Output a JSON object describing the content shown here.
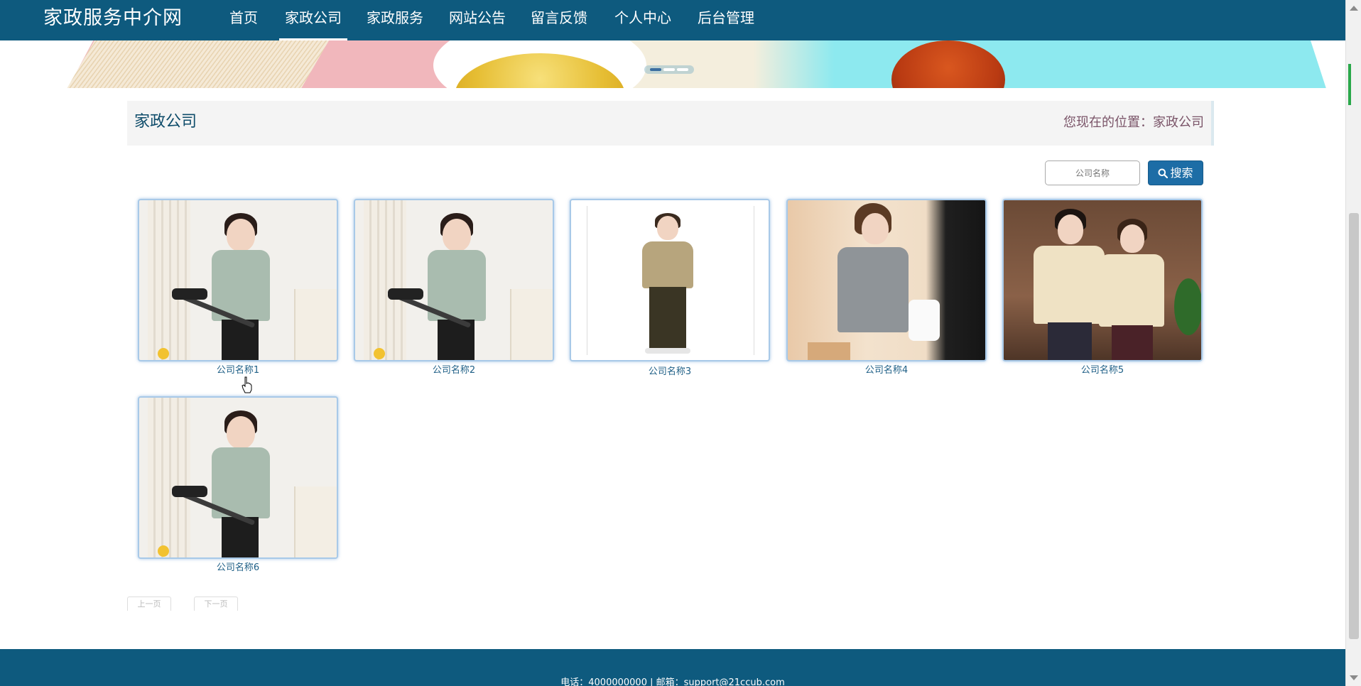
{
  "brand": "家政服务中介网",
  "nav": [
    {
      "label": "首页"
    },
    {
      "label": "家政公司"
    },
    {
      "label": "家政服务"
    },
    {
      "label": "网站公告"
    },
    {
      "label": "留言反馈"
    },
    {
      "label": "个人中心"
    },
    {
      "label": "后台管理"
    }
  ],
  "nav_active": "家政公司",
  "page_title": "家政公司",
  "location": "您现在的位置：家政公司",
  "search": {
    "placeholder": "公司名称",
    "button_label": "搜索",
    "button_icon": "search-icon"
  },
  "companies": [
    {
      "name": "公司名称1"
    },
    {
      "name": "公司名称2"
    },
    {
      "name": "公司名称3"
    },
    {
      "name": "公司名称4"
    },
    {
      "name": "公司名称5"
    },
    {
      "name": "公司名称6"
    }
  ],
  "pager": {
    "prev": "上一页",
    "next": "下一页"
  },
  "footer": {
    "text": "电话：4000000000 | 邮箱：support@21ccub.com"
  },
  "colors": {
    "nav_bg": "#0e5a7e",
    "accent": "#1d6da6",
    "caption": "#1e5f86"
  }
}
